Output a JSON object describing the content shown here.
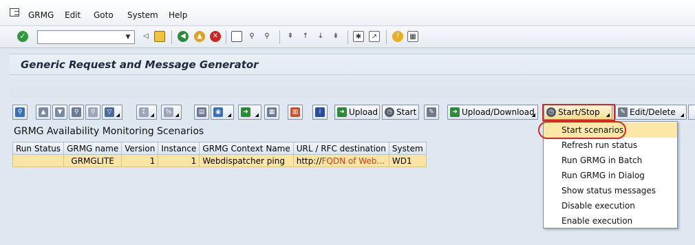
{
  "menubar": {
    "items": [
      "GRMG",
      "Edit",
      "Goto",
      "System",
      "Help"
    ]
  },
  "title": "Generic Request and Message Generator",
  "toolbar": {
    "upload_label": "Upload",
    "start_label": "Start",
    "upload_download_label": "Upload/Download",
    "start_stop_label": "Start/Stop",
    "edit_delete_label": "Edit/Delete"
  },
  "section_title": "GRMG Availability Monitoring Scenarios",
  "table": {
    "columns": [
      "Run Status",
      "GRMG name",
      "Version",
      "Instance",
      "GRMG Context Name",
      "URL / RFC destination",
      "System"
    ],
    "rows": [
      {
        "run_status": "",
        "name": "GRMGLITE",
        "version": "1",
        "instance": "1",
        "context": "Webdispatcher ping",
        "url_prefix": "http://",
        "url_rest": "FQDN of Web...",
        "system": "WD1"
      }
    ]
  },
  "dropdown": {
    "items": [
      "Start scenarios",
      "Refresh run status",
      "Run GRMG in Batch",
      "Run GRMG in Dialog",
      "Show status messages",
      "Disable execution",
      "Enable execution"
    ]
  },
  "colors": {
    "accent_red": "#d9281e",
    "row_highlight": "#fbe5a6",
    "background": "#dfe7f1"
  }
}
